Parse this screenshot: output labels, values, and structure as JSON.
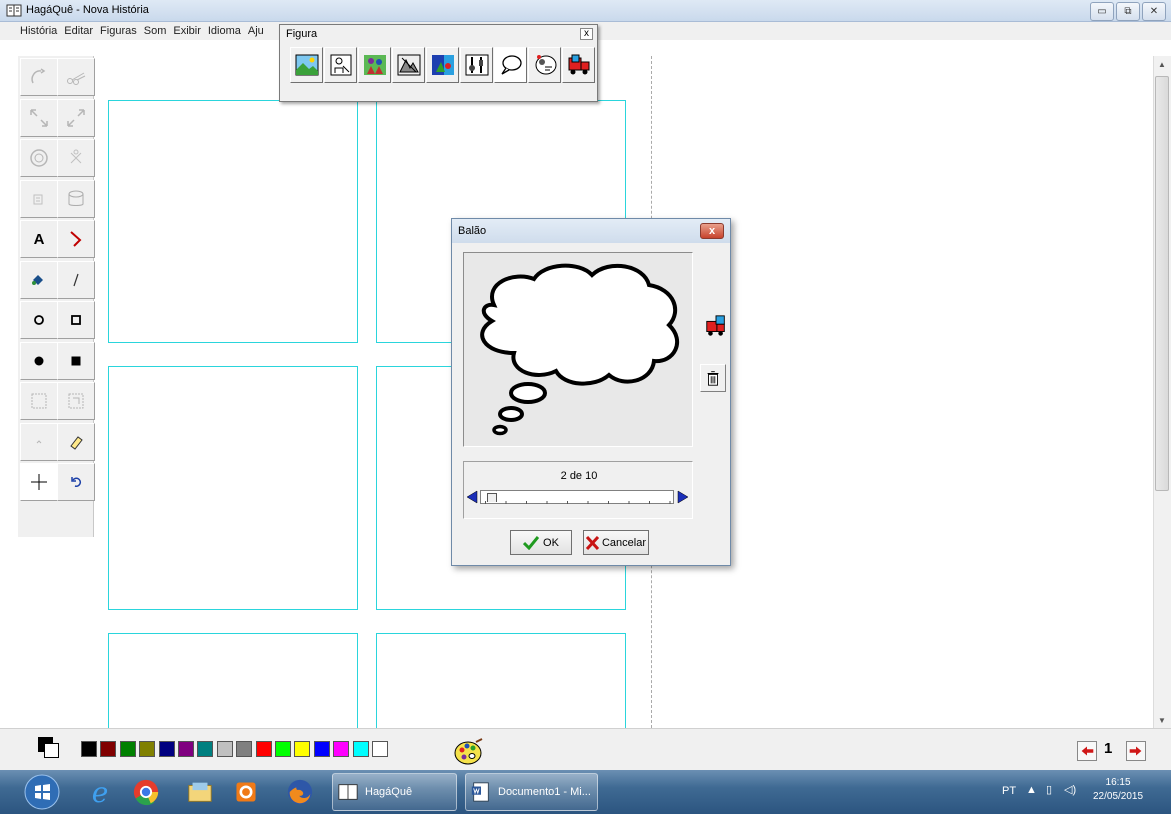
{
  "window": {
    "title": "HagáQuê - Nova História",
    "controls": [
      "minimize",
      "restore",
      "close"
    ]
  },
  "menu": [
    "História",
    "Editar",
    "Figuras",
    "Som",
    "Exibir",
    "Idioma",
    "Aju"
  ],
  "figura_palette": {
    "title": "Figura",
    "close": "x",
    "buttons": [
      "cenario",
      "personagem",
      "grupo",
      "objetos",
      "fundo-colorido",
      "objeto-ferramentas",
      "balao",
      "onomatopeia",
      "importar"
    ]
  },
  "dialog": {
    "title": "Balão",
    "close": "x",
    "counter": "2 de 10",
    "ok": "OK",
    "cancel": "Cancelar"
  },
  "colors": [
    "#000000",
    "#800000",
    "#008000",
    "#808000",
    "#000080",
    "#800080",
    "#008080",
    "#c0c0c0",
    "#808080",
    "#ff0000",
    "#00ff00",
    "#ffff00",
    "#0000ff",
    "#ff00ff",
    "#00ffff",
    "#ffffff"
  ],
  "page_number": "1",
  "taskbar": {
    "tasks": [
      {
        "label": "HagáQuê"
      },
      {
        "label": "Documento1 - Mi..."
      }
    ],
    "language": "PT",
    "time": "16:15",
    "date": "22/05/2015"
  }
}
